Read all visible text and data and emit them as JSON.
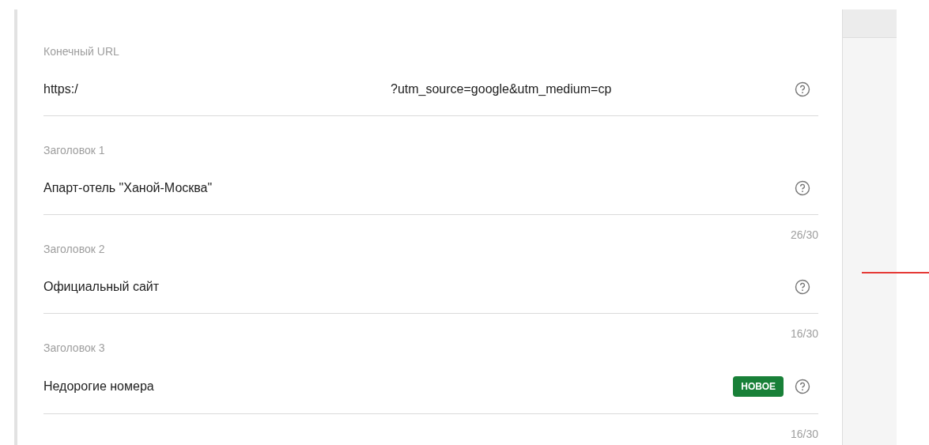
{
  "fields": [
    {
      "kind": "url",
      "label": "Конечный URL",
      "value_parts": [
        "https:/",
        "?utm_source=google&utm_medium=cp"
      ]
    },
    {
      "kind": "text",
      "label": "Заголовок 1",
      "value": "Апарт-отель \"Ханой-Москва\"",
      "counter": "26/30"
    },
    {
      "kind": "text",
      "label": "Заголовок 2",
      "value": "Официальный сайт",
      "counter": "16/30"
    },
    {
      "kind": "text",
      "label": "Заголовок 3",
      "value": "Недорогие номера",
      "badge": "НОВОЕ",
      "counter": "16/30"
    }
  ]
}
